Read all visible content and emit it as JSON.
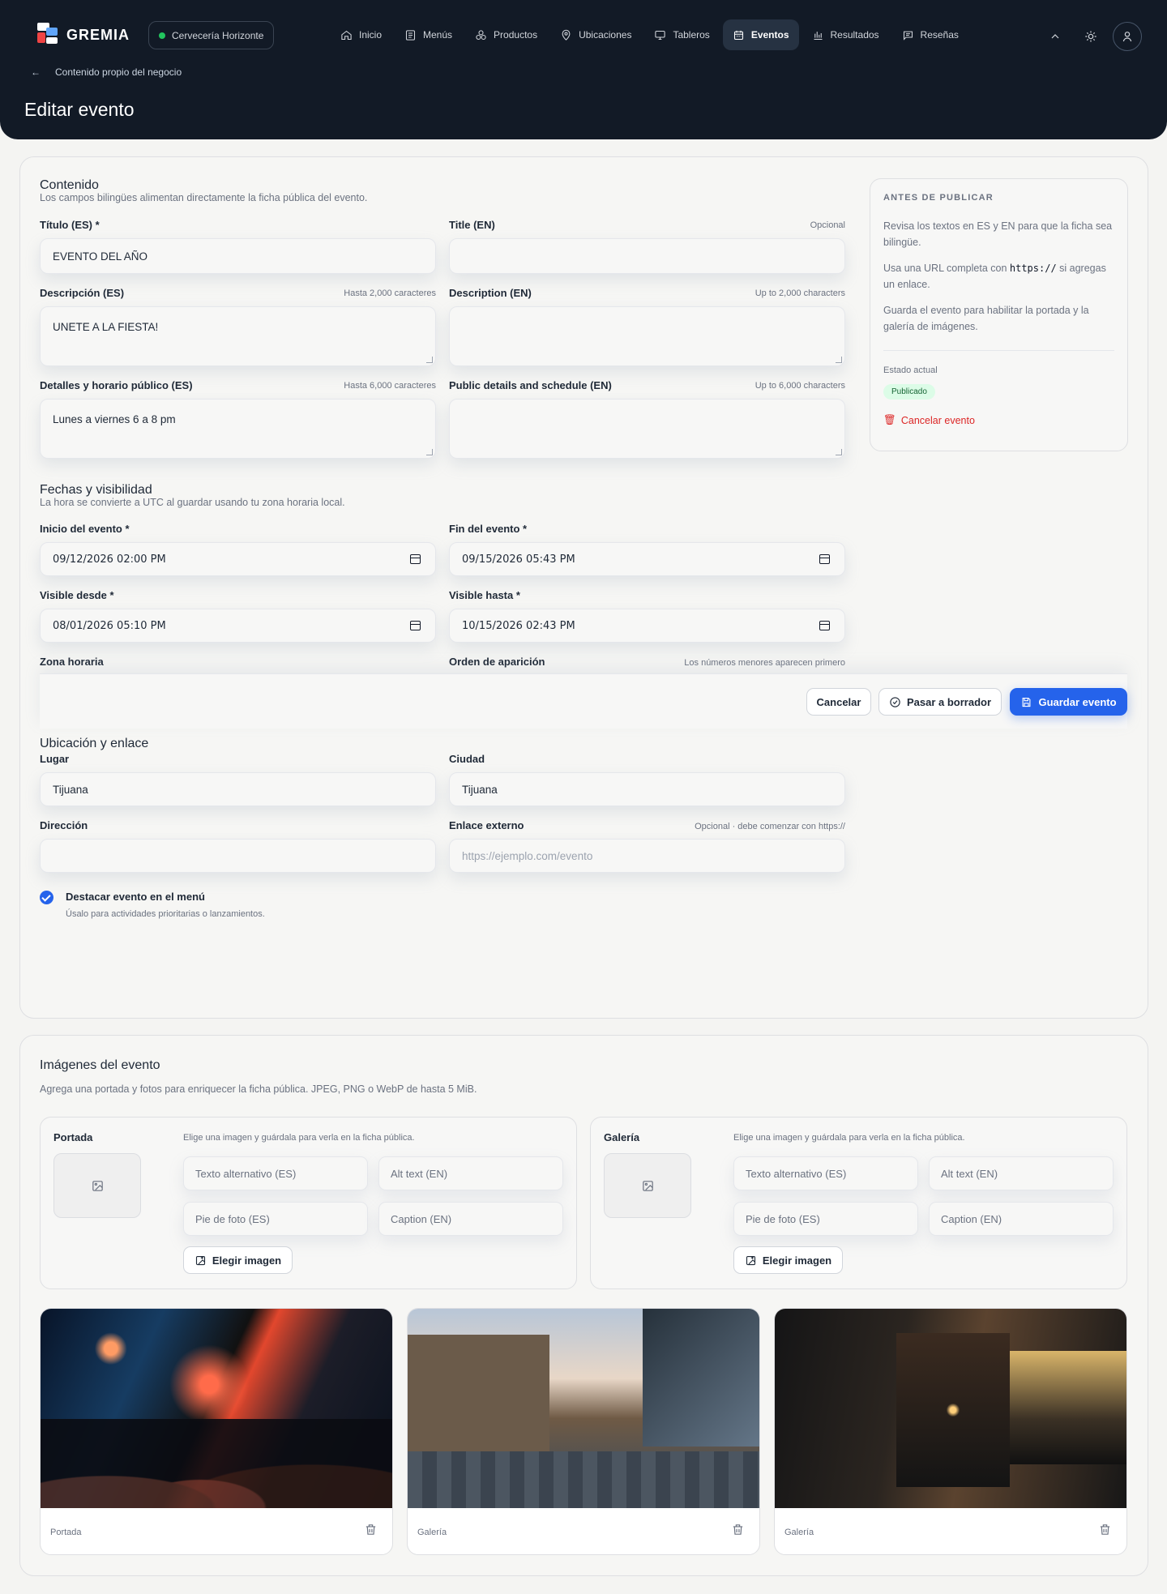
{
  "app": {
    "logo": "GREMIA",
    "business": "Cervecería Horizonte",
    "nav": [
      {
        "label": "Inicio",
        "icon": "home-icon"
      },
      {
        "label": "Menús",
        "icon": "menu-book-icon"
      },
      {
        "label": "Productos",
        "icon": "box-icon"
      },
      {
        "label": "Ubicaciones",
        "icon": "location-icon"
      },
      {
        "label": "Tableros",
        "icon": "monitor-icon"
      },
      {
        "label": "Eventos",
        "icon": "calendar-icon",
        "active": true
      },
      {
        "label": "Resultados",
        "icon": "chart-icon"
      },
      {
        "label": "Reseñas",
        "icon": "review-icon"
      }
    ],
    "breadcrumb": "Contenido propio del negocio",
    "title": "Editar evento"
  },
  "content": {
    "title": "Contenido",
    "subtitle": "Los campos bilingües alimentan directamente la ficha pública del evento.",
    "title_es": {
      "label": "Título (ES) *",
      "value": "EVENTO DEL AÑO"
    },
    "title_en": {
      "label": "Title (EN)",
      "hint": "Opcional",
      "value": ""
    },
    "desc_es": {
      "label": "Descripción (ES)",
      "hint": "Hasta 2,000 caracteres",
      "value": "UNETE A LA FIESTA!"
    },
    "desc_en": {
      "label": "Description (EN)",
      "hint": "Up to 2,000 characters",
      "value": ""
    },
    "details_es": {
      "label": "Detalles y horario público (ES)",
      "hint": "Hasta 6,000 caracteres",
      "value": "Lunes a viernes 6 a 8 pm"
    },
    "details_en": {
      "label": "Public details and schedule (EN)",
      "hint": "Up to 6,000 characters",
      "value": ""
    }
  },
  "dates": {
    "title": "Fechas y visibilidad",
    "subtitle": "La hora se convierte a UTC al guardar usando tu zona horaria local.",
    "start": {
      "label": "Inicio del evento *",
      "value": "09/12/2026 02:00 PM"
    },
    "end": {
      "label": "Fin del evento *",
      "value": "09/15/2026 05:43 PM"
    },
    "visible_from": {
      "label": "Visible desde *",
      "value": "08/01/2026 05:10 PM"
    },
    "visible_to": {
      "label": "Visible hasta *",
      "value": "10/15/2026 02:43 PM"
    },
    "timezone": {
      "label": "Zona horaria"
    },
    "order": {
      "label": "Orden de aparición",
      "hint": "Los números menores aparecen primero"
    }
  },
  "actions": {
    "cancel": "Cancelar",
    "draft": "Pasar a borrador",
    "save": "Guardar evento"
  },
  "location": {
    "title": "Ubicación y enlace",
    "place": {
      "label": "Lugar",
      "value": "Tijuana"
    },
    "city": {
      "label": "Ciudad",
      "value": "Tijuana"
    },
    "address": {
      "label": "Dirección",
      "value": ""
    },
    "link": {
      "label": "Enlace externo",
      "hint": "Opcional · debe comenzar con https://",
      "placeholder": "https://ejemplo.com/evento"
    },
    "featured": {
      "label": "Destacar evento en el menú",
      "help": "Úsalo para actividades prioritarias o lanzamientos.",
      "checked": true
    }
  },
  "sidebar": {
    "title": "ANTES DE PUBLICAR",
    "p1": "Revisa los textos en ES y EN para que la ficha sea bilingüe.",
    "p2a": "Usa una URL completa con ",
    "p2code": "https://",
    "p2b": " si agregas un enlace.",
    "p3": "Guarda el evento para habilitar la portada y la galería de imágenes.",
    "status_label": "Estado actual",
    "status": "Publicado",
    "cancel": "Cancelar evento"
  },
  "images": {
    "title": "Imágenes del evento",
    "subtitle": "Agrega una portada y fotos para enriquecer la ficha pública. JPEG, PNG o WebP de hasta 5 MiB.",
    "panels": [
      {
        "name": "Portada",
        "hint": "Elige una imagen y guárdala para verla en la ficha pública.",
        "alt_es": "Texto alternativo (ES)",
        "alt_en": "Alt text (EN)",
        "cap_es": "Pie de foto (ES)",
        "cap_en": "Caption (EN)",
        "button": "Elegir imagen"
      },
      {
        "name": "Galería",
        "hint": "Elige una imagen y guárdala para verla en la ficha pública.",
        "alt_es": "Texto alternativo (ES)",
        "alt_en": "Alt text (EN)",
        "cap_es": "Pie de foto (ES)",
        "cap_en": "Caption (EN)",
        "button": "Elegir imagen"
      }
    ],
    "photos": [
      {
        "label": "Portada"
      },
      {
        "label": "Galería"
      },
      {
        "label": "Galería"
      }
    ]
  }
}
